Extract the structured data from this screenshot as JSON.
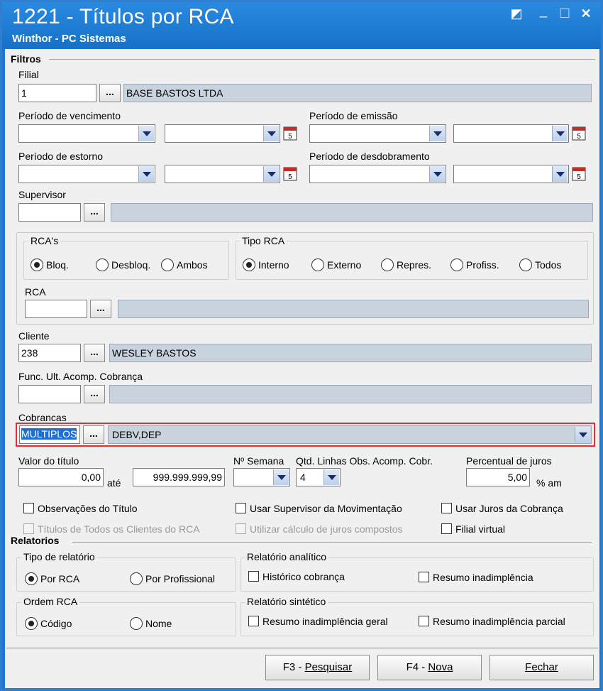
{
  "window": {
    "title": "1221 - Títulos por RCA",
    "subtitle": "Winthor - PC Sistemas",
    "controls": {
      "restore": "◩",
      "minimize": "_",
      "maximize": "☐",
      "close": "✕"
    }
  },
  "filtros": {
    "legend": "Filtros",
    "filial": {
      "label": "Filial",
      "code": "1",
      "lookup_btn": "...",
      "name": "BASE BASTOS LTDA"
    },
    "periodo_vencimento": {
      "label": "Período de vencimento",
      "from": "",
      "to": ""
    },
    "periodo_emissao": {
      "label": "Período de emissão",
      "from": "",
      "to": ""
    },
    "periodo_estorno": {
      "label": "Período de estorno",
      "from": "",
      "to": ""
    },
    "periodo_desdobramento": {
      "label": "Período de desdobramento",
      "from": "",
      "to": ""
    },
    "supervisor": {
      "label": "Supervisor",
      "code": "",
      "lookup_btn": "...",
      "name": ""
    },
    "rcas": {
      "legend": "RCA's",
      "options": [
        "Bloq.",
        "Desbloq.",
        "Ambos"
      ],
      "selected": "Bloq."
    },
    "tipo_rca": {
      "legend": "Tipo RCA",
      "options": [
        "Interno",
        "Externo",
        "Repres.",
        "Profiss.",
        "Todos"
      ],
      "selected": "Interno"
    },
    "rca": {
      "label": "RCA",
      "code": "",
      "lookup_btn": "...",
      "name": ""
    },
    "cliente": {
      "label": "Cliente",
      "code": "238",
      "lookup_btn": "...",
      "name": "WESLEY BASTOS"
    },
    "func_ult": {
      "label": "Func. Ult. Acomp. Cobrança",
      "code": "",
      "lookup_btn": "...",
      "name": ""
    },
    "cobrancas": {
      "label": "Cobrancas",
      "code": "MULTIPLOS",
      "lookup_btn": "...",
      "value": "DEBV,DEP"
    },
    "valor_titulo": {
      "label": "Valor do título",
      "from": "0,00",
      "ate": "até",
      "to": "999.999.999,99"
    },
    "num_semana": {
      "label": "Nº Semana",
      "value": ""
    },
    "qtd_linhas": {
      "label": "Qtd. Linhas Obs. Acomp. Cobr.",
      "value": "4"
    },
    "percentual_juros": {
      "label": "Percentual de juros",
      "value": "5,00",
      "unit": "% am"
    },
    "checks": {
      "observacoes": "Observações do Título",
      "usar_supervisor": "Usar Supervisor da Movimentação",
      "usar_juros": "Usar Juros da Cobrança",
      "titulos_todos": "Títulos de Todos os Clientes do RCA",
      "calculo_compostos": "Utilizar cálculo de juros compostos",
      "filial_virtual": "Filial virtual"
    }
  },
  "relatorios": {
    "legend": "Relatorios",
    "tipo_relatorio": {
      "legend": "Tipo de relatório",
      "options": [
        "Por RCA",
        "Por Profissional"
      ],
      "selected": "Por RCA"
    },
    "ordem_rca": {
      "legend": "Ordem RCA",
      "options": [
        "Código",
        "Nome"
      ],
      "selected": "Código"
    },
    "analitico": {
      "legend": "Relatório analítico",
      "historico": "Histórico cobrança",
      "resumo": "Resumo inadimplência"
    },
    "sintetico": {
      "legend": "Relatório sintético",
      "geral": "Resumo inadimplência geral",
      "parcial": "Resumo inadimplência parcial"
    }
  },
  "footer": {
    "pesquisar_key": "F3 - ",
    "pesquisar": "Pesquisar",
    "nova_key": "F4 - ",
    "nova": "Nova",
    "fechar": "Fechar"
  }
}
